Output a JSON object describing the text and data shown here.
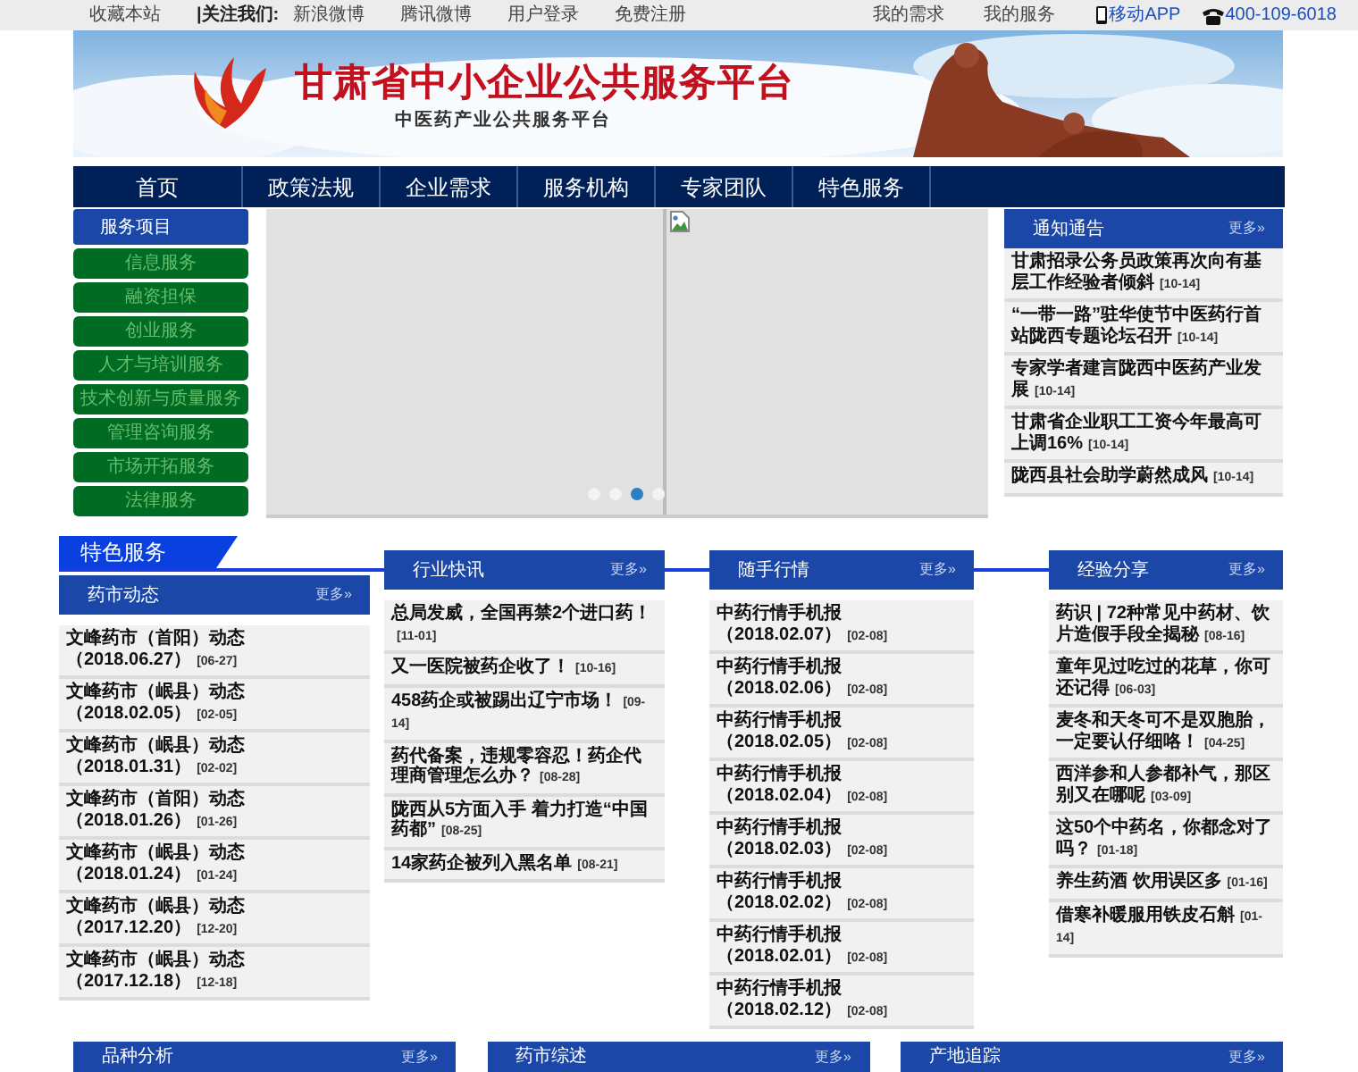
{
  "top_bar": {
    "left": [
      {
        "text": "收藏本站",
        "bold": false
      },
      {
        "text": "|关注我们:",
        "bold": true
      },
      {
        "text": "新浪微博",
        "bold": false
      },
      {
        "text": "腾讯微博",
        "bold": false
      },
      {
        "text": "用户登录",
        "bold": false
      },
      {
        "text": "免费注册",
        "bold": false
      }
    ],
    "right": [
      {
        "text": "我的需求",
        "kind": "link"
      },
      {
        "text": "我的服务",
        "kind": "link"
      },
      {
        "text": "移动APP",
        "kind": "mobile"
      },
      {
        "text": "400-109-6018",
        "kind": "phone"
      }
    ]
  },
  "banner": {
    "title": "甘肃省中小企业公共服务平台",
    "subtitle": "中医药产业公共服务平台"
  },
  "nav": [
    "首页",
    "政策法规",
    "企业需求",
    "服务机构",
    "专家团队",
    "特色服务"
  ],
  "sidebar": {
    "title": "服务项目",
    "items": [
      "信息服务",
      "融资担保",
      "创业服务",
      "人才与培训服务",
      "技术创新与质量服务",
      "管理咨询服务",
      "市场开拓服务",
      "法律服务"
    ]
  },
  "carousel": {
    "dots": [
      {
        "selected": false
      },
      {
        "selected": false
      },
      {
        "selected": true
      },
      {
        "selected": false
      }
    ]
  },
  "notice": {
    "title": "通知通告",
    "more": "更多»",
    "items": [
      {
        "title": "甘肃招录公务员政策再次向有基层工作经验者倾斜",
        "date": "[10-14]"
      },
      {
        "title": "“一带一路”驻华使节中医药行首站陇西专题论坛召开",
        "date": "[10-14]"
      },
      {
        "title": "专家学者建言陇西中医药产业发展",
        "date": "[10-14]"
      },
      {
        "title": "甘肃省企业职工工资今年最高可上调16%",
        "date": "[10-14]"
      },
      {
        "title": "陇西县社会助学蔚然成风",
        "date": "[10-14]"
      }
    ]
  },
  "feature_title": "特色服务",
  "panels": [
    {
      "title": "药市动态",
      "more": "更多»",
      "items": [
        {
          "title": "文峰药市（首阳）动态（2018.06.27）",
          "date": "[06-27]"
        },
        {
          "title": "文峰药市（岷县）动态（2018.02.05）",
          "date": "[02-05]"
        },
        {
          "title": "文峰药市（岷县）动态（2018.01.31）",
          "date": "[02-02]"
        },
        {
          "title": "文峰药市（首阳）动态（2018.01.26）",
          "date": "[01-26]"
        },
        {
          "title": "文峰药市（岷县）动态（2018.01.24）",
          "date": "[01-24]"
        },
        {
          "title": "文峰药市（岷县）动态（2017.12.20）",
          "date": "[12-20]"
        },
        {
          "title": "文峰药市（岷县）动态（2017.12.18）",
          "date": "[12-18]"
        }
      ]
    },
    {
      "title": "行业快讯",
      "more": "更多»",
      "items": [
        {
          "title": "总局发威，全国再禁2个进口药！",
          "date": "[11-01]"
        },
        {
          "title": "又一医院被药企收了！",
          "date": "[10-16]"
        },
        {
          "title": "458药企或被踢出辽宁市场！",
          "date": "[09-14]"
        },
        {
          "title": "药代备案，违规零容忍！药企代理商管理怎么办？",
          "date": "[08-28]"
        },
        {
          "title": "陇西从5方面入手 着力打造“中国药都”",
          "date": "[08-25]"
        },
        {
          "title": "14家药企被列入黑名单",
          "date": "[08-21]"
        }
      ]
    },
    {
      "title": "随手行情",
      "more": "更多»",
      "items": [
        {
          "title": "中药行情手机报（2018.02.07）",
          "date": "[02-08]"
        },
        {
          "title": "中药行情手机报（2018.02.06）",
          "date": "[02-08]"
        },
        {
          "title": "中药行情手机报（2018.02.05）",
          "date": "[02-08]"
        },
        {
          "title": "中药行情手机报（2018.02.04）",
          "date": "[02-08]"
        },
        {
          "title": "中药行情手机报（2018.02.03）",
          "date": "[02-08]"
        },
        {
          "title": "中药行情手机报（2018.02.02）",
          "date": "[02-08]"
        },
        {
          "title": "中药行情手机报（2018.02.01）",
          "date": "[02-08]"
        },
        {
          "title": "中药行情手机报（2018.02.12）",
          "date": "[02-08]"
        }
      ]
    },
    {
      "title": "经验分享",
      "more": "更多»",
      "items": [
        {
          "title": "药识 | 72种常见中药材、饮片造假手段全揭秘",
          "date": "[08-16]"
        },
        {
          "title": "童年见过吃过的花草，你可还记得",
          "date": "[06-03]"
        },
        {
          "title": "麦冬和天冬可不是双胞胎，一定要认仔细咯！",
          "date": "[04-25]"
        },
        {
          "title": "西洋参和人参都补气，那区别又在哪呢",
          "date": "[03-09]"
        },
        {
          "title": "这50个中药名，你都念对了吗？",
          "date": "[01-18]"
        },
        {
          "title": "养生药酒 饮用误区多",
          "date": "[01-16]"
        },
        {
          "title": "借寒补暖服用铁皮石斛",
          "date": "[01-14]"
        }
      ]
    }
  ],
  "bottom_panels": [
    {
      "title": "品种分析",
      "more": "更多»"
    },
    {
      "title": "药市综述",
      "more": "更多»"
    },
    {
      "title": "产地追踪",
      "more": "更多»"
    }
  ]
}
